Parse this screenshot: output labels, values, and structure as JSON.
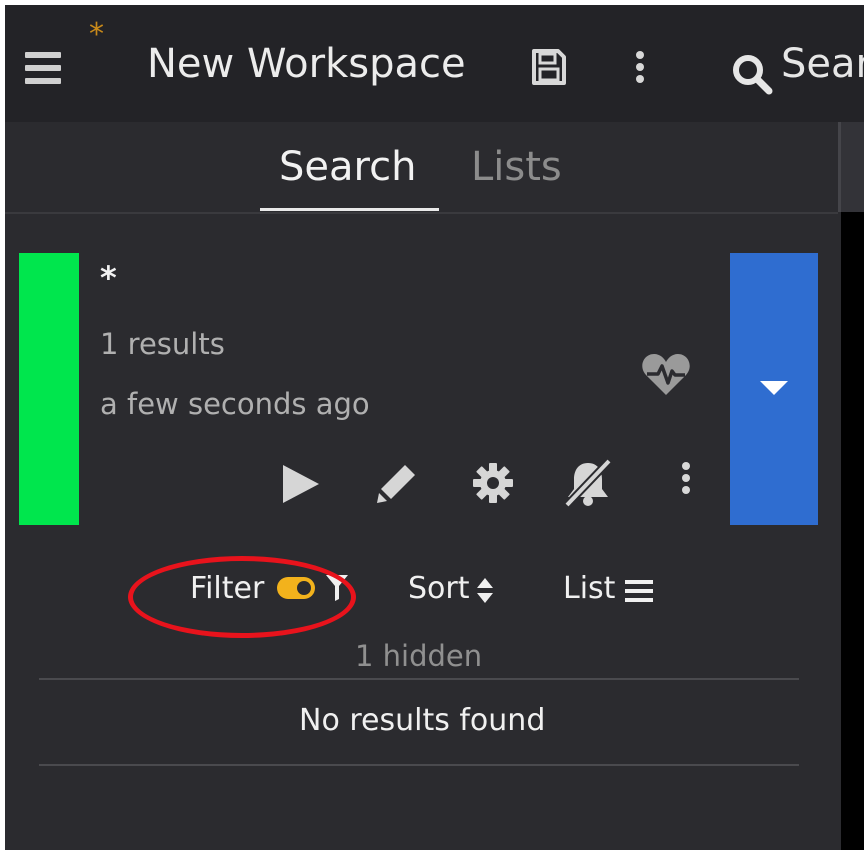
{
  "header": {
    "modified_marker": "*",
    "workspace_title": "New Workspace",
    "search_label": "Sear"
  },
  "tabs": [
    {
      "label": "Search",
      "active": true
    },
    {
      "label": "Lists",
      "active": false
    }
  ],
  "search_card": {
    "name": "*",
    "results": "1 results",
    "updated": "a few seconds ago",
    "status_color": "#00e64d",
    "dropdown_color": "#2f6dd0"
  },
  "controls": {
    "filter_label": "Filter",
    "sort_label": "Sort",
    "list_label": "List",
    "filter_toggle_color": "#f2b21c"
  },
  "results": {
    "hidden": "1 hidden",
    "empty_message": "No results found"
  },
  "annotation": {
    "color": "#e8131c"
  }
}
